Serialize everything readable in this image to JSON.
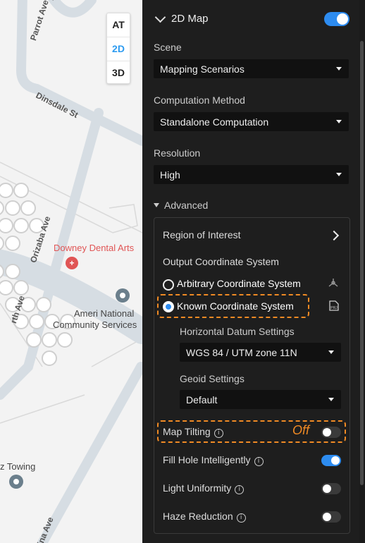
{
  "map": {
    "view_buttons": [
      {
        "label": "AT",
        "active": false
      },
      {
        "label": "2D",
        "active": true
      },
      {
        "label": "3D",
        "active": false
      }
    ],
    "streets": {
      "parrot_ave": "Parrot Ave",
      "dinsdale_st": "Dinsdale St",
      "orizaba_ave": "Orizaba Ave",
      "top_partial": "Pa",
      "left_partial": "rth Ave",
      "bottom_partial": "ina Ave"
    },
    "places": {
      "dental": "Downey Dental Arts",
      "ameri_line1": "Ameri National",
      "ameri_line2": "Community Services",
      "towing": "z Towing"
    },
    "colors": {
      "dental": "#e05555",
      "marker": "#6b7f8c"
    }
  },
  "panel": {
    "header": {
      "title": "2D Map",
      "enabled": true
    },
    "scene": {
      "label": "Scene",
      "value": "Mapping Scenarios"
    },
    "computation": {
      "label": "Computation Method",
      "value": "Standalone Computation"
    },
    "resolution": {
      "label": "Resolution",
      "value": "High"
    },
    "advanced": {
      "label": "Advanced",
      "region_of_interest": "Region of Interest",
      "output_coord_label": "Output Coordinate System",
      "arbitrary": {
        "label": "Arbitrary Coordinate System",
        "checked": false
      },
      "known": {
        "label": "Known Coordinate System",
        "checked": true
      },
      "horizontal_datum": {
        "label": "Horizontal Datum Settings",
        "value": "WGS 84 / UTM zone 11N"
      },
      "geoid": {
        "label": "Geoid Settings",
        "value": "Default"
      },
      "map_tilting": {
        "label": "Map Tilting",
        "enabled": false,
        "annotation": "Off"
      },
      "fill_hole": {
        "label": "Fill Hole Intelligently",
        "enabled": true
      },
      "light_uniformity": {
        "label": "Light Uniformity",
        "enabled": false
      },
      "haze_reduction": {
        "label": "Haze Reduction",
        "enabled": false
      }
    },
    "colors": {
      "accent": "#2d8cf0",
      "highlight": "#f08a24",
      "background": "#1e1e1e"
    }
  }
}
